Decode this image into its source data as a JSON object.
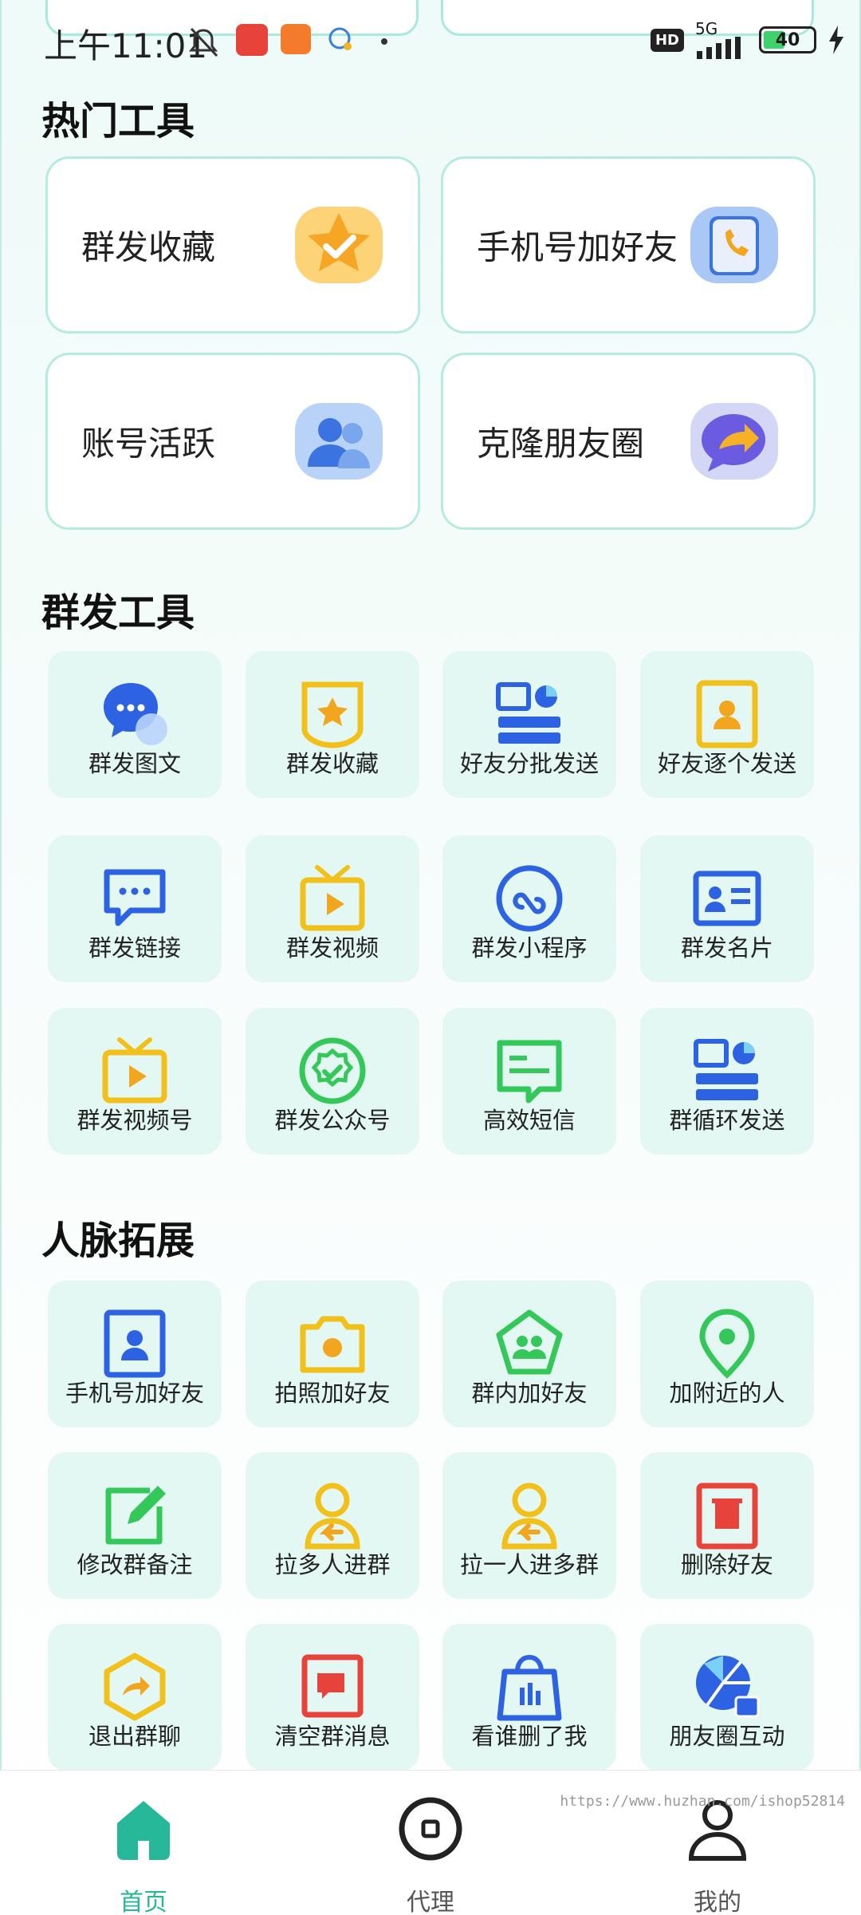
{
  "status_bar": {
    "time": "上午11:01",
    "network": "5G",
    "hd": "HD",
    "battery": "40"
  },
  "hot_tools": {
    "title": "热门工具",
    "items": [
      {
        "label": "群发收藏",
        "icon": "star-icon"
      },
      {
        "label": "手机号加好友",
        "icon": "phone-book-icon"
      },
      {
        "label": "账号活跃",
        "icon": "users-icon"
      },
      {
        "label": "克隆朋友圈",
        "icon": "share-bubble-icon"
      }
    ]
  },
  "mass_send": {
    "title": "群发工具",
    "items": [
      {
        "label": "群发图文",
        "icon": "chat-bubbles-icon"
      },
      {
        "label": "群发收藏",
        "icon": "star-badge-icon"
      },
      {
        "label": "好友分批发送",
        "icon": "batch-send-icon"
      },
      {
        "label": "好友逐个发送",
        "icon": "contact-card-icon"
      },
      {
        "label": "群发链接",
        "icon": "link-message-icon"
      },
      {
        "label": "群发视频",
        "icon": "tv-play-icon"
      },
      {
        "label": "群发小程序",
        "icon": "mini-program-icon"
      },
      {
        "label": "群发名片",
        "icon": "name-card-icon"
      },
      {
        "label": "群发视频号",
        "icon": "video-channel-icon"
      },
      {
        "label": "群发公众号",
        "icon": "official-account-icon"
      },
      {
        "label": "高效短信",
        "icon": "sms-icon"
      },
      {
        "label": "群循环发送",
        "icon": "loop-send-icon"
      }
    ]
  },
  "network_expand": {
    "title": "人脉拓展",
    "items": [
      {
        "label": "手机号加好友",
        "icon": "phone-contact-icon"
      },
      {
        "label": "拍照加好友",
        "icon": "camera-icon"
      },
      {
        "label": "群内加好友",
        "icon": "group-pentagon-icon"
      },
      {
        "label": "加附近的人",
        "icon": "location-pin-icon"
      },
      {
        "label": "修改群备注",
        "icon": "edit-icon"
      },
      {
        "label": "拉多人进群",
        "icon": "pull-many-icon"
      },
      {
        "label": "拉一人进多群",
        "icon": "pull-one-icon"
      },
      {
        "label": "删除好友",
        "icon": "trash-icon"
      },
      {
        "label": "退出群聊",
        "icon": "exit-hexagon-icon"
      },
      {
        "label": "清空群消息",
        "icon": "clear-chat-icon"
      },
      {
        "label": "看谁删了我",
        "icon": "shopping-bag-icon"
      },
      {
        "label": "朋友圈互动",
        "icon": "moments-icon"
      }
    ]
  },
  "bottom_nav": {
    "items": [
      {
        "label": "首页",
        "icon": "home-icon",
        "active": true
      },
      {
        "label": "代理",
        "icon": "agent-icon",
        "active": false
      },
      {
        "label": "我的",
        "icon": "profile-icon",
        "active": false
      }
    ]
  },
  "watermark": "https://www.huzhan.com/ishop52814",
  "colors": {
    "accent": "#27b89a",
    "tile_bg": "#e3f8f2",
    "card_border": "#b6ecdf"
  }
}
